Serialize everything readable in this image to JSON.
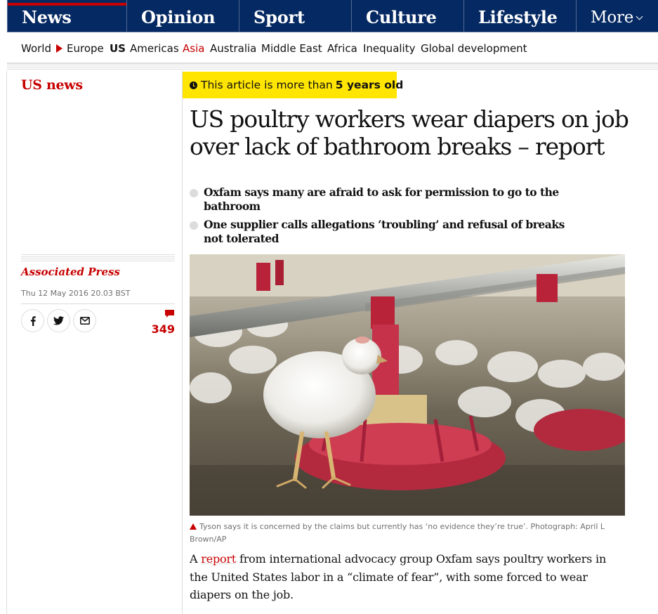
{
  "nav": {
    "pillars": [
      {
        "label": "News",
        "active": true
      },
      {
        "label": "Opinion",
        "active": false
      },
      {
        "label": "Sport",
        "active": false
      },
      {
        "label": "Culture",
        "active": false
      },
      {
        "label": "Lifestyle",
        "active": false
      }
    ],
    "more_label": "More",
    "subnav": [
      "World",
      "Europe",
      "US",
      "Americas",
      "Asia",
      "Australia",
      "Middle East",
      "Africa",
      "Inequality",
      "Global development"
    ]
  },
  "section": "US news",
  "age_warning": {
    "prefix": "This article is more than",
    "age": "5 years old"
  },
  "headline": "US poultry workers wear diapers on job over lack of bathroom breaks – report",
  "standfirst": [
    "Oxfam says many are afraid to ask for permission to go to the bathroom",
    "One supplier calls allegations ‘troubling’ and refusal of breaks not tolerated"
  ],
  "byline": "Associated Press",
  "dateline": "Thu 12 May 2016 20.03 BST",
  "share": [
    "facebook-icon",
    "twitter-icon",
    "email-icon"
  ],
  "comments_count": "349",
  "caption": "Tyson says it is concerned by the claims but currently has ‘no evidence they’re true’. Photograph: April L Brown/AP",
  "body": {
    "pre": "A",
    "link": "report",
    "post": "from international advocacy group Oxfam says poultry workers in the United States labor in a “climate of fear”, with some forced to wear diapers on the job."
  },
  "colors": {
    "brand_navy": "#052962",
    "news_red": "#c70000",
    "badge_yellow": "#ffe500"
  }
}
